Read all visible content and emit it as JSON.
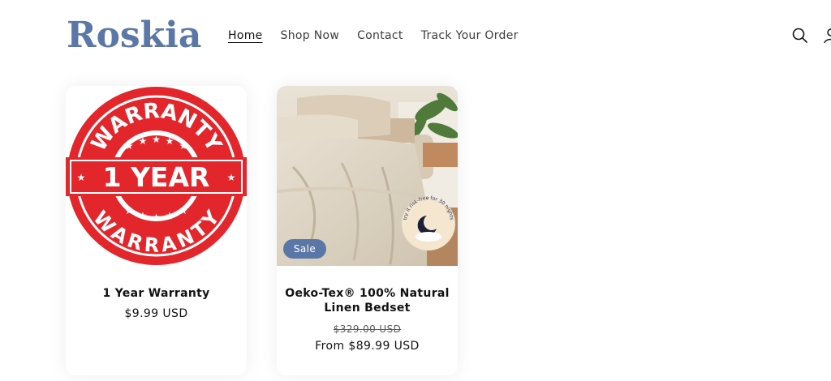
{
  "brand": {
    "logo_text": "Roskia"
  },
  "nav": {
    "items": [
      {
        "label": "Home",
        "active": true
      },
      {
        "label": "Shop Now",
        "active": false
      },
      {
        "label": "Contact",
        "active": false
      },
      {
        "label": "Track Your Order",
        "active": false
      }
    ]
  },
  "header_icons": {
    "search": "search-icon",
    "account": "account-icon"
  },
  "products": [
    {
      "title": "1 Year Warranty",
      "price": "$9.99 USD",
      "image": {
        "top_text": "WARRANTY",
        "center_text": "1 YEAR",
        "bottom_text": "WARRANTY",
        "color": "#e3262b"
      }
    },
    {
      "title": "Oeko-Tex® 100% Natural Linen Bedset",
      "badge": "Sale",
      "compare_price": "$329.00 USD",
      "price": "From $89.99 USD",
      "image": {
        "sticker_text": "try it risk-free for 30 nights"
      }
    }
  ],
  "colors": {
    "brand": "#5b77a8",
    "sale_badge": "#5b77a8",
    "text": "#121212",
    "warranty_red": "#e3262b"
  }
}
